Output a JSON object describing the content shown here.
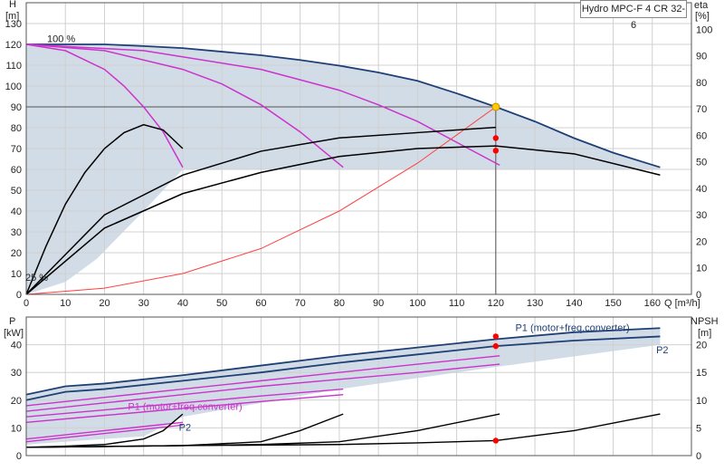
{
  "chart_data": [
    {
      "type": "line",
      "title": "Hydro MPC-F 4 CR 32-6",
      "xlabel": "Q [m³/h]",
      "ylabel_left_top": "H",
      "ylabel_left_unit": "[m]",
      "ylabel_right_top": "eta",
      "ylabel_right_unit": "[%]",
      "xlim": [
        0,
        170
      ],
      "ylim_left": [
        0,
        140
      ],
      "ylim_right": [
        0,
        110
      ],
      "x_ticks": [
        0,
        10,
        20,
        30,
        40,
        50,
        60,
        70,
        80,
        90,
        100,
        110,
        120,
        130,
        140,
        150,
        160
      ],
      "y_ticks_left": [
        0,
        10,
        20,
        30,
        40,
        50,
        60,
        70,
        80,
        90,
        100,
        110,
        120,
        130
      ],
      "y_ticks_right": [
        0,
        10,
        20,
        30,
        40,
        50,
        60,
        70,
        80,
        90,
        100
      ],
      "speed_labels": [
        "100 %",
        "25 %"
      ],
      "duty_point": {
        "q": 120,
        "h": 90
      },
      "reference_lines": {
        "h": 90,
        "q": 120
      },
      "colors": {
        "envelope_fill": "#c9d6e3",
        "max_curve": "#1f3f77",
        "magenta": "#cc33cc",
        "system_curve": "#ff4040",
        "black": "#000000",
        "duty_marker": "#ffcc00",
        "point_marker": "#ff0000"
      },
      "series": [
        {
          "role": "max-head",
          "color": "#1f3f77",
          "x": [
            0,
            10,
            20,
            30,
            40,
            50,
            60,
            70,
            80,
            90,
            100,
            110,
            120,
            130,
            140,
            150,
            162
          ],
          "y": [
            120,
            120,
            120,
            119.2,
            118.2,
            116.5,
            114.8,
            112.5,
            109.8,
            106.5,
            102.5,
            96.5,
            90,
            83,
            75,
            68,
            61
          ]
        },
        {
          "role": "head-1pump",
          "color": "#cc33cc",
          "x": [
            0,
            10,
            20,
            25,
            30,
            35,
            40
          ],
          "y": [
            120,
            117,
            108,
            100,
            90,
            78,
            61
          ]
        },
        {
          "role": "head-2pumps",
          "color": "#cc33cc",
          "x": [
            0,
            20,
            40,
            50,
            60,
            70,
            81
          ],
          "y": [
            120,
            117,
            108,
            101,
            91,
            78,
            61
          ]
        },
        {
          "role": "head-3pumps",
          "color": "#cc33cc",
          "x": [
            0,
            30,
            60,
            70,
            80,
            90,
            100,
            121
          ],
          "y": [
            120,
            117,
            108,
            103,
            98,
            91,
            83,
            62
          ]
        },
        {
          "role": "system-curve",
          "color": "#ff4040",
          "x": [
            0,
            20,
            40,
            60,
            80,
            100,
            120
          ],
          "y": [
            0,
            3,
            10,
            22,
            40,
            63,
            90
          ]
        },
        {
          "role": "eta-1pump",
          "color": "#000000",
          "axis": "right",
          "x": [
            0,
            5,
            10,
            15,
            20,
            25,
            30,
            35,
            40
          ],
          "y": [
            0,
            18,
            34,
            46,
            55,
            61,
            64,
            62,
            55
          ]
        },
        {
          "role": "eta-3pumps",
          "color": "#000000",
          "axis": "right",
          "x": [
            0,
            20,
            40,
            60,
            80,
            100,
            110,
            120
          ],
          "y": [
            0,
            30,
            45,
            54,
            59,
            61,
            62,
            63
          ]
        },
        {
          "role": "eta-4pumps",
          "color": "#000000",
          "axis": "right",
          "x": [
            0,
            20,
            40,
            60,
            80,
            100,
            120,
            140,
            162
          ],
          "y": [
            0,
            25,
            38,
            46,
            52,
            55,
            56,
            53,
            45
          ]
        }
      ],
      "points": [
        {
          "q": 120,
          "value": 90,
          "axis": "left",
          "color": "#ffcc00"
        },
        {
          "q": 120,
          "value": 75,
          "axis": "left",
          "color": "#ff0000"
        },
        {
          "q": 120,
          "value": 69,
          "axis": "left",
          "color": "#ff0000"
        }
      ]
    },
    {
      "type": "line",
      "ylabel_left_top": "P",
      "ylabel_left_unit": "[kW]",
      "ylabel_right_top": "NPSH",
      "ylabel_right_unit": "[m]",
      "xlim": [
        0,
        170
      ],
      "ylim_left": [
        0,
        50
      ],
      "ylim_right": [
        0,
        25
      ],
      "y_ticks_left": [
        0,
        10,
        20,
        30,
        40
      ],
      "y_ticks_right": [
        0,
        5,
        10,
        15,
        20
      ],
      "series_labels": [
        {
          "text": "P1 (motor+freq.converter)",
          "q": 125,
          "value": 45,
          "color": "#1f3f77"
        },
        {
          "text": "P2",
          "q": 161,
          "value": 37,
          "color": "#1f3f77"
        },
        {
          "text": "P1 (motor+freq.converter)",
          "q": 26,
          "value": 16.5,
          "color": "#cc33cc"
        },
        {
          "text": "P2",
          "q": 39,
          "value": 9,
          "color": "#1f3f77"
        }
      ],
      "series": [
        {
          "name": "P1 (motor+freq.converter)",
          "color": "#1f3f77",
          "x": [
            0,
            10,
            20,
            40,
            60,
            80,
            100,
            120,
            140,
            162
          ],
          "y": [
            22,
            25,
            26,
            29,
            32.5,
            36,
            39,
            42,
            44.5,
            46
          ]
        },
        {
          "name": "P2",
          "color": "#1f3f77",
          "x": [
            0,
            10,
            20,
            40,
            60,
            80,
            100,
            120,
            140,
            162
          ],
          "y": [
            20,
            23,
            24,
            27,
            30,
            33.5,
            36.5,
            39.5,
            41.5,
            43
          ]
        },
        {
          "role": "P1-3pumps",
          "color": "#cc33cc",
          "x": [
            0,
            20,
            40,
            60,
            80,
            100,
            121
          ],
          "y": [
            18,
            21,
            24,
            27,
            30,
            33,
            36
          ]
        },
        {
          "role": "P2-3pumps",
          "color": "#cc33cc",
          "x": [
            0,
            20,
            40,
            60,
            80,
            100,
            121
          ],
          "y": [
            16,
            19,
            22,
            25,
            27.5,
            30,
            33
          ]
        },
        {
          "role": "P1-2pumps",
          "color": "#cc33cc",
          "x": [
            0,
            20,
            40,
            60,
            81
          ],
          "y": [
            14,
            16.5,
            19,
            21.5,
            24
          ]
        },
        {
          "role": "P2-2pumps",
          "color": "#cc33cc",
          "x": [
            0,
            20,
            40,
            60,
            81
          ],
          "y": [
            12,
            14.5,
            17,
            19.5,
            22
          ]
        },
        {
          "role": "P1-1pump",
          "color": "#cc33cc",
          "x": [
            0,
            10,
            20,
            30,
            40
          ],
          "y": [
            6,
            7.5,
            9,
            10.5,
            12
          ]
        },
        {
          "role": "P2-1pump",
          "color": "#cc33cc",
          "x": [
            0,
            10,
            20,
            30,
            40
          ],
          "y": [
            5,
            6.5,
            8,
            9.5,
            11
          ]
        },
        {
          "role": "NPSH-4pumps",
          "color": "#000000",
          "axis": "right",
          "x": [
            0,
            40,
            80,
            100,
            120,
            140,
            162
          ],
          "y": [
            1.5,
            1.8,
            2,
            2.3,
            2.7,
            4.5,
            7.5
          ]
        },
        {
          "role": "NPSH-3pumps",
          "color": "#000000",
          "axis": "right",
          "x": [
            0,
            40,
            60,
            80,
            100,
            121
          ],
          "y": [
            1.5,
            1.8,
            2,
            2.5,
            4.5,
            7.5
          ]
        },
        {
          "role": "NPSH-2pumps",
          "color": "#000000",
          "axis": "right",
          "x": [
            0,
            40,
            60,
            70,
            81
          ],
          "y": [
            1.5,
            1.8,
            2.5,
            4.5,
            7.5
          ]
        },
        {
          "role": "NPSH-1pump",
          "color": "#000000",
          "axis": "right",
          "x": [
            0,
            10,
            20,
            30,
            35,
            40
          ],
          "y": [
            1.5,
            1.7,
            2,
            3,
            4.5,
            7.5
          ]
        }
      ],
      "points": [
        {
          "q": 120,
          "value": 43,
          "axis": "left",
          "color": "#ff0000"
        },
        {
          "q": 120,
          "value": 39.5,
          "axis": "left",
          "color": "#ff0000"
        },
        {
          "q": 120,
          "value": 2.7,
          "axis": "right",
          "color": "#ff0000"
        }
      ]
    }
  ]
}
